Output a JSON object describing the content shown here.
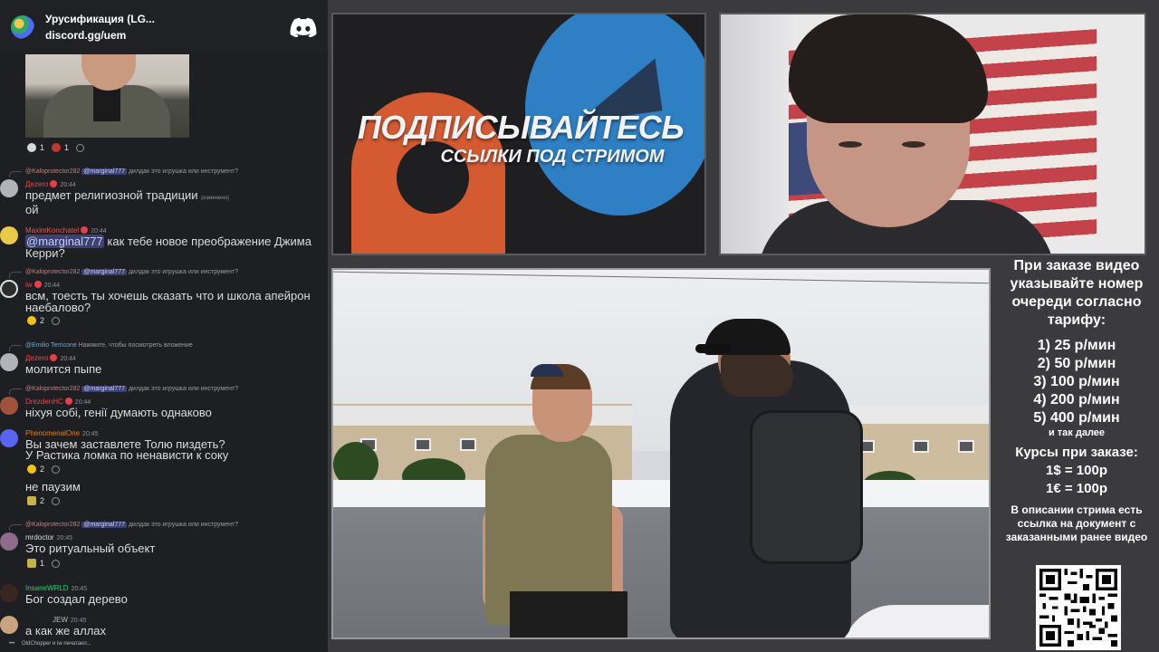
{
  "chat": {
    "server_name": "Урусификация (LG...",
    "server_link": "discord.gg/uem",
    "typing": "OldChopper и iw печатают...",
    "messages": [
      {
        "reply": {
          "name": "@Kaloprotector282",
          "mention": "@marginal777",
          "text": "дилдак это игрушка или инструмент?"
        },
        "user": "Дezero",
        "user_color": "#f04747",
        "time": "20:44",
        "lines": [
          "предмет религиозной традиции",
          "ой"
        ],
        "edited": "(изменено)"
      },
      {
        "user": "MaximKonchatel",
        "user_color": "#e35a5a",
        "time": "20:44",
        "mention": "@marginal777",
        "lines": [
          "как тебе новое преображение Джима",
          "Керри?"
        ]
      },
      {
        "reply": {
          "name": "@Kaloprotector282",
          "mention": "@marginal777",
          "text": "дилдак это игрушка или инструмент?"
        },
        "user": "iw",
        "user_color": "#f04747",
        "time": "20:44",
        "lines": [
          "всм, тоесть ты хочешь сказать что и школа апейрон",
          "наебалово?"
        ],
        "reactions": [
          {
            "count": "2"
          }
        ]
      },
      {
        "reply": {
          "name": "@Emilio Terricone",
          "text": "Нажмите, чтобы посмотреть вложение"
        },
        "user": "Дezero",
        "user_color": "#f04747",
        "time": "20:44",
        "lines": [
          "молится пыпе"
        ]
      },
      {
        "reply": {
          "name": "@Kaloprotector282",
          "mention": "@marginal777",
          "text": "дилдак это игрушка или инструмент?"
        },
        "user": "DrezdenHC",
        "user_color": "#f04747",
        "time": "20:44",
        "lines": [
          "ніхуя собі, генії думають однаково"
        ]
      },
      {
        "user": "PhenomenalOne",
        "user_color": "#e67e22",
        "time": "20:45",
        "lines": [
          "Вы зачем заставлете Толю пиздеть?",
          "У Растика ломка по ненависти к соку"
        ],
        "reactions": [
          {
            "count": "2"
          }
        ],
        "followup": "не паузим",
        "followup_reactions": [
          {
            "count": "2"
          }
        ]
      },
      {
        "reply": {
          "name": "@Kaloprotector282",
          "mention": "@marginal777",
          "text": "дилдак это игрушка или инструмент?"
        },
        "user": "mrdoctor",
        "user_color": "#dcddde",
        "time": "20:45",
        "lines": [
          "Это ритуальный объект"
        ],
        "reactions": [
          {
            "count": "1"
          }
        ]
      },
      {
        "user": "InsaneWRLD",
        "user_color": "#2ecc71",
        "time": "20:45",
        "lines": [
          "Бог создал дерево"
        ]
      },
      {
        "user": "",
        "user_color": "#2ecc71",
        "tag": "JEW",
        "time": "20:45",
        "lines": [
          "а как же аллах"
        ]
      }
    ],
    "embed_reactions": [
      "1",
      "1"
    ]
  },
  "promo": {
    "title": "ПОДПИСЫВАЙТЕСЬ",
    "subtitle": "ССЫЛКИ ПОД СТРИМОМ"
  },
  "info": {
    "heading": "При заказе видео указывайте номер очереди согласно тарифу:",
    "tariffs": [
      "1) 25 р/мин",
      "2) 50 р/мин",
      "3) 100 р/мин",
      "4) 200 р/мин",
      "5) 400 р/мин"
    ],
    "tariff_note": "и так далее",
    "rates_title": "Курсы при заказе:",
    "rates": [
      "1$ = 100р",
      "1€ = 100р"
    ],
    "doc_note": "В описании стрима есть ссылка на документ с заказанными ранее видео"
  },
  "colors": {
    "chat_bg": "#1e1f22",
    "stage_bg": "#3b3b3d",
    "mention_bg": "#3c4270",
    "mention_fg": "#c9cdfb",
    "telegram_blue": "#2e7fc3",
    "patreon_orange": "#d45a32",
    "discord_logo": "#ffffff"
  },
  "icons": {
    "server": "server-avatar-icon",
    "discord": "discord-logo-icon",
    "qr": "qr-code"
  }
}
